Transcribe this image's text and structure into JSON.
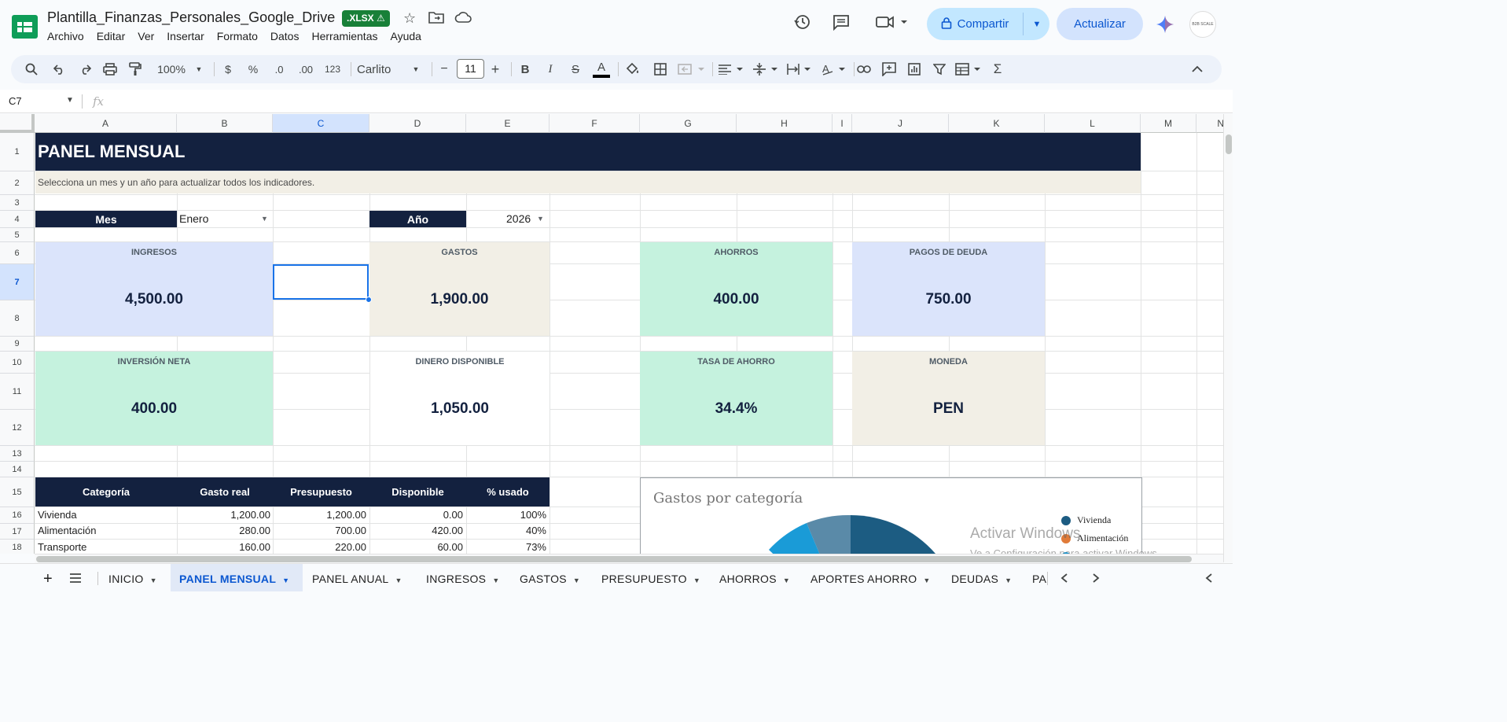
{
  "document": {
    "title": "Plantilla_Finanzas_Personales_Google_Drive",
    "badge": ".XLSX ⚠"
  },
  "menu": [
    "Archivo",
    "Editar",
    "Ver",
    "Insertar",
    "Formato",
    "Datos",
    "Herramientas",
    "Ayuda"
  ],
  "header": {
    "share_label": "Compartir",
    "update_label": "Actualizar",
    "avatar_text": "B2B SCALE"
  },
  "toolbar": {
    "zoom": "100%",
    "currency": "$",
    "percent": "%",
    "dec_decrease": ".0",
    "dec_increase": ".00",
    "number_format": "123",
    "font": "Carlito",
    "font_size": "11",
    "bold": "B",
    "italic": "I",
    "strike": "S",
    "text_color": "A",
    "sum": "Σ"
  },
  "formula_bar": {
    "cell_ref": "C7",
    "fx": "fx"
  },
  "columns": [
    "A",
    "B",
    "C",
    "D",
    "E",
    "F",
    "G",
    "H",
    "I",
    "J",
    "K",
    "L",
    "M",
    "N"
  ],
  "rows": [
    "1",
    "2",
    "3",
    "4",
    "5",
    "6",
    "7",
    "8",
    "9",
    "10",
    "11",
    "12",
    "13",
    "14",
    "15",
    "16",
    "17",
    "18"
  ],
  "sheet": {
    "title": "PANEL MENSUAL",
    "instruction": "Selecciona un mes y un año para actualizar todos los indicadores.",
    "month_label": "Mes",
    "month_value": "Enero",
    "year_label": "Año",
    "year_value": "2026"
  },
  "kpis": {
    "ingresos": {
      "label": "INGRESOS",
      "value": "4,500.00"
    },
    "gastos": {
      "label": "GASTOS",
      "value": "1,900.00"
    },
    "ahorros": {
      "label": "AHORROS",
      "value": "400.00"
    },
    "pagos_deuda": {
      "label": "PAGOS DE DEUDA",
      "value": "750.00"
    },
    "inversion_neta": {
      "label": "INVERSIÓN NETA",
      "value": "400.00"
    },
    "dinero_disponible": {
      "label": "DINERO DISPONIBLE",
      "value": "1,050.00"
    },
    "tasa_ahorro": {
      "label": "TASA DE AHORRO",
      "value": "34.4%"
    },
    "moneda": {
      "label": "MONEDA",
      "value": "PEN"
    }
  },
  "table": {
    "headers": [
      "Categoría",
      "Gasto real",
      "Presupuesto",
      "Disponible",
      "% usado"
    ],
    "rows": [
      [
        "Vivienda",
        "1,200.00",
        "1,200.00",
        "0.00",
        "100%"
      ],
      [
        "Alimentación",
        "280.00",
        "700.00",
        "420.00",
        "40%"
      ],
      [
        "Transporte",
        "160.00",
        "220.00",
        "60.00",
        "73%"
      ]
    ]
  },
  "chart": {
    "title": "Gastos por categoría",
    "legend": [
      "Vivienda",
      "Alimentación"
    ],
    "colors": [
      "#1c5c82",
      "#e07b39",
      "#1a9bd7",
      "#5a8aa8"
    ]
  },
  "watermark": {
    "title": "Activar Windows",
    "subtitle": "Ve a Configuración para activar Windows."
  },
  "sheet_tabs": [
    "INICIO",
    "PANEL MENSUAL",
    "PANEL ANUAL",
    "INGRESOS",
    "GASTOS",
    "PRESUPUESTO",
    "AHORROS",
    "APORTES AHORRO",
    "DEUDAS",
    "PA"
  ],
  "colors": {
    "navy": "#13213f",
    "blue_card": "#dbe4fb",
    "beige_card": "#f2efe6",
    "green_card": "#c5f2de",
    "accent": "#0b57d0"
  }
}
